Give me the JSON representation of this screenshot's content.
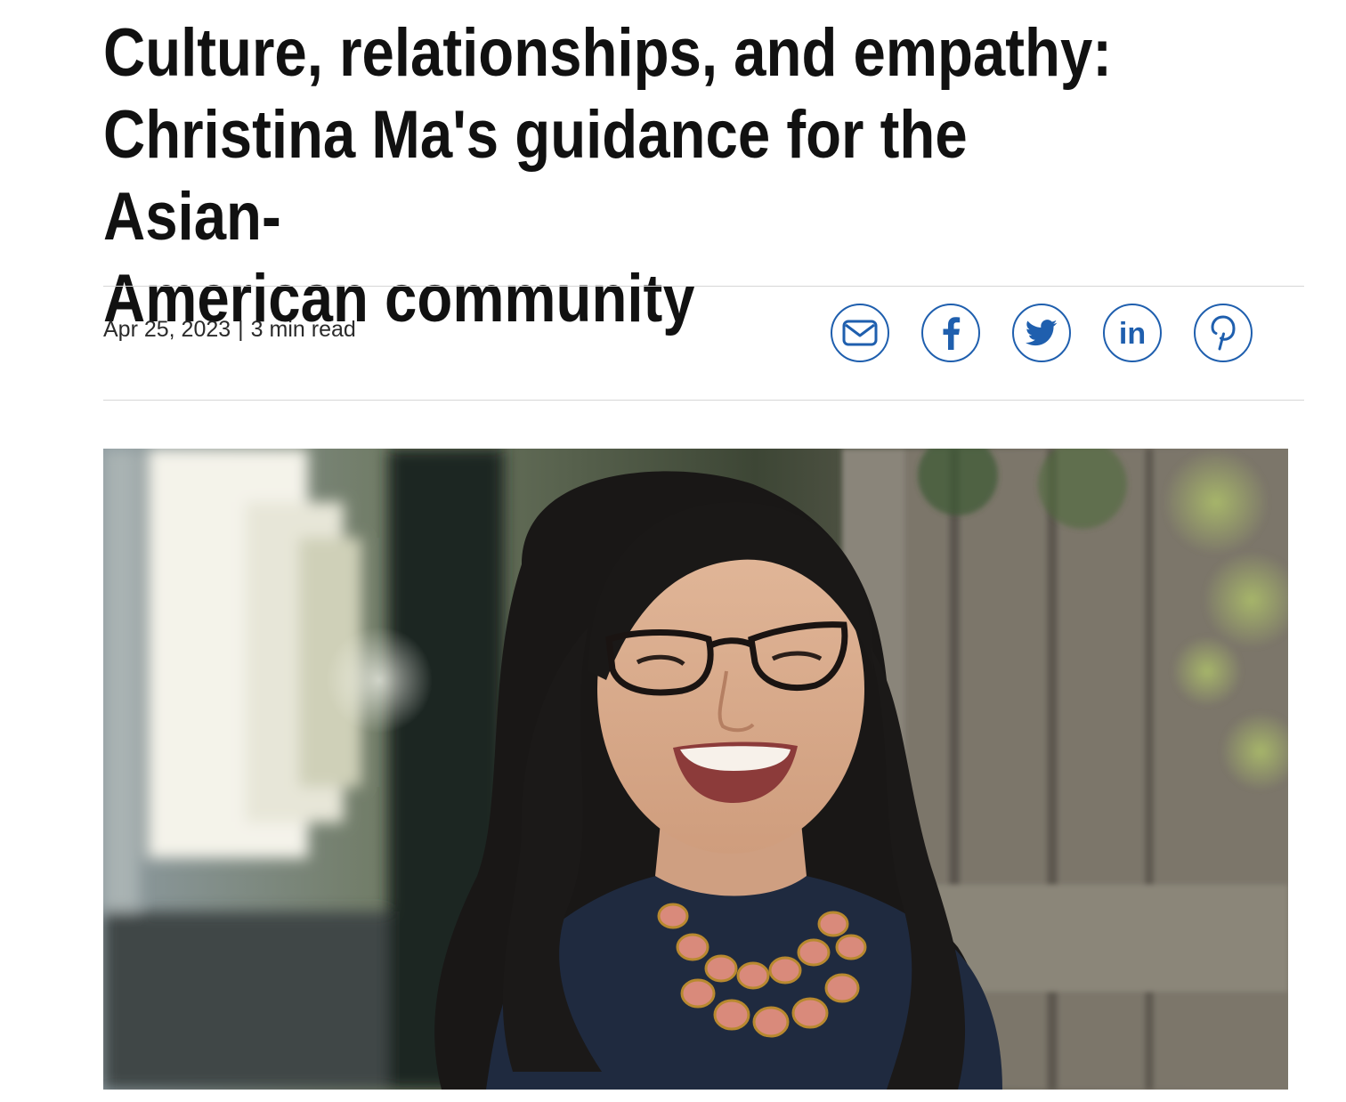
{
  "article": {
    "title": "Culture, relationships, and empathy:\nChristina Ma's guidance for the Asian-\nAmerican community",
    "date": "Apr 25, 2023",
    "separator": "|",
    "read_time": "3 min read"
  },
  "share": {
    "buttons": [
      {
        "icon": "email-icon"
      },
      {
        "icon": "facebook-icon"
      },
      {
        "icon": "twitter-icon"
      },
      {
        "icon": "linkedin-icon",
        "glyph": "in"
      },
      {
        "icon": "pinterest-icon"
      }
    ],
    "color": "#1f5fae"
  },
  "photo": {
    "subject": "smiling woman with glasses and coral necklace"
  }
}
